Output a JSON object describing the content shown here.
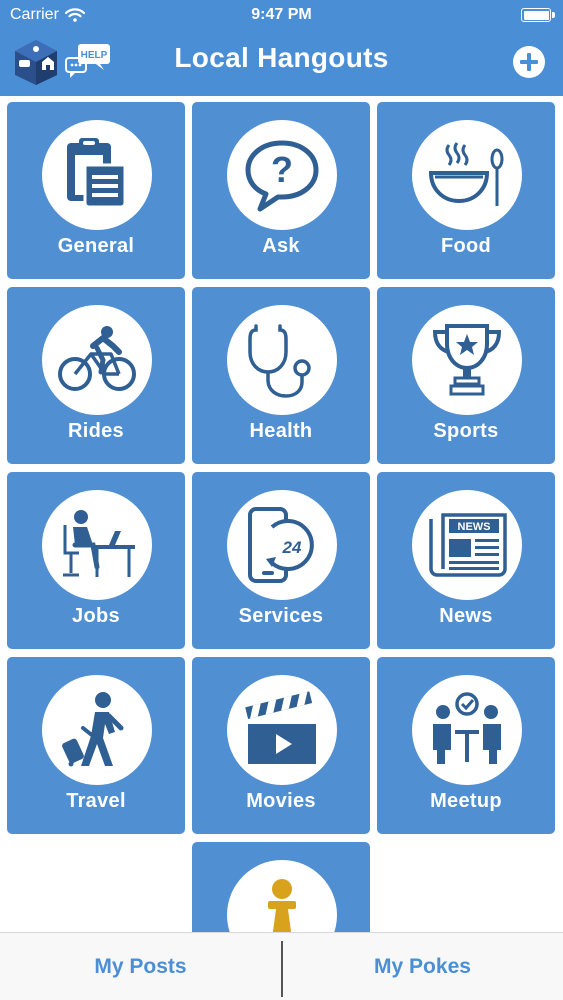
{
  "status_bar": {
    "carrier": "Carrier",
    "time": "9:47 PM"
  },
  "nav": {
    "title": "Local Hangouts",
    "help_badge": "HELP"
  },
  "categories": [
    {
      "label": "General",
      "icon": "clipboard-icon"
    },
    {
      "label": "Ask",
      "icon": "question-bubble-icon"
    },
    {
      "label": "Food",
      "icon": "soup-bowl-icon"
    },
    {
      "label": "Rides",
      "icon": "cyclist-icon"
    },
    {
      "label": "Health",
      "icon": "stethoscope-icon"
    },
    {
      "label": "Sports",
      "icon": "trophy-icon"
    },
    {
      "label": "Jobs",
      "icon": "desk-worker-icon"
    },
    {
      "label": "Services",
      "icon": "phone-24-icon",
      "badge": "24"
    },
    {
      "label": "News",
      "icon": "newspaper-icon",
      "badge": "NEWS"
    },
    {
      "label": "Travel",
      "icon": "traveler-icon"
    },
    {
      "label": "Movies",
      "icon": "clapperboard-icon"
    },
    {
      "label": "Meetup",
      "icon": "meetup-icon"
    },
    {
      "label": "",
      "icon": "chess-pawn-icon"
    }
  ],
  "tabs": {
    "my_posts": "My Posts",
    "my_pokes": "My Pokes"
  },
  "colors": {
    "primary": "#4a8fd6",
    "tile": "#4f8fd2",
    "icon": "#2f5f93",
    "pawn": "#d9a21c"
  }
}
